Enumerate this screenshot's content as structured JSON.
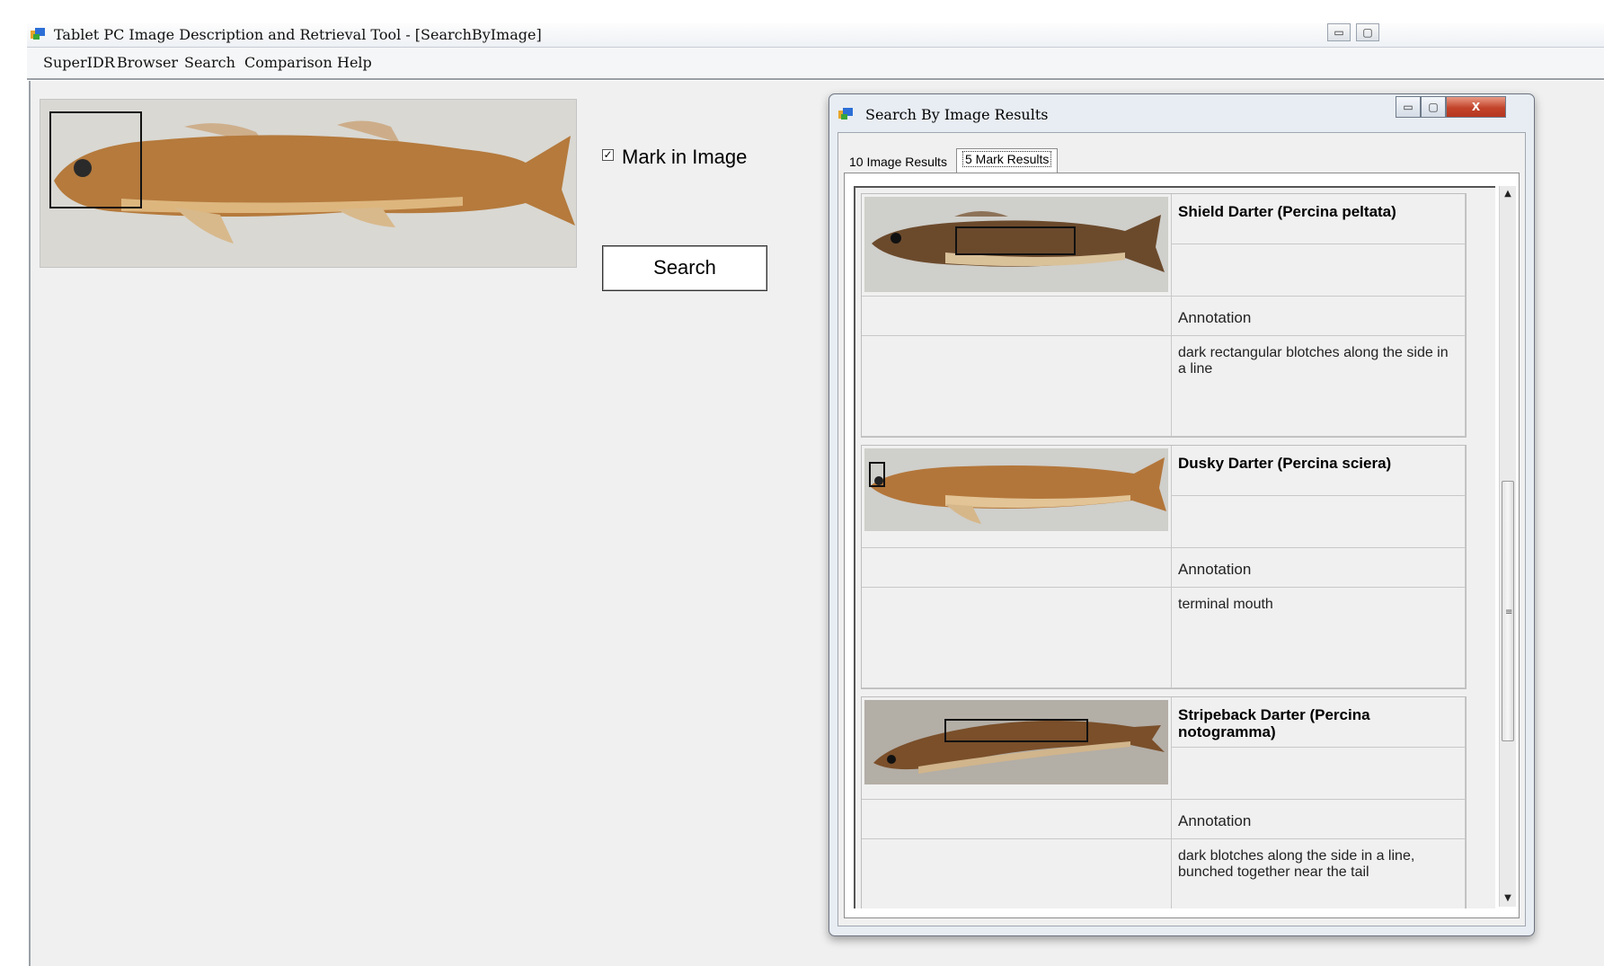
{
  "main_window": {
    "title": "Tablet PC Image Description and Retrieval Tool - [SearchByImage]",
    "minimize": "▭",
    "maximize": "▢"
  },
  "menu": [
    "SuperIDR",
    "Browser",
    "Search",
    "Comparison",
    "Help"
  ],
  "query": {
    "mark_label": "Mark in Image",
    "mark_checked": "✓",
    "search_label": "Search"
  },
  "dialog": {
    "title": "Search By Image Results",
    "minimize": "▭",
    "maximize": "▢",
    "close": "X",
    "tabs": [
      "10 Image Results",
      "5 Mark Results"
    ],
    "results": [
      {
        "species": "Shield Darter (Percina peltata)",
        "annotation_label": "Annotation",
        "annotation": "dark rectangular blotches along the side  in a line"
      },
      {
        "species": "Dusky Darter (Percina sciera)",
        "annotation_label": "Annotation",
        "annotation": "terminal mouth"
      },
      {
        "species": "Stripeback Darter (Percina notogramma)",
        "annotation_label": "Annotation",
        "annotation": "dark blotches along the side in a line, bunched together near the tail"
      }
    ],
    "scroll_up": "▲",
    "scroll_down": "▼",
    "scroll_grip": "≡"
  }
}
